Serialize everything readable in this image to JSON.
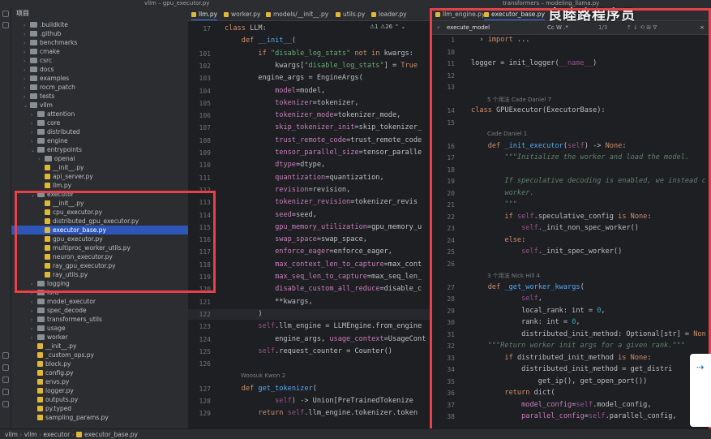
{
  "window": {
    "title_left": "vllm – gpu_executor.py",
    "title_right": "transformers – modeling_llama.py"
  },
  "project": {
    "header": "项目",
    "rows": [
      {
        "label": ".buildkite",
        "kind": "folder",
        "depth": 1,
        "arrow": "›"
      },
      {
        "label": ".github",
        "kind": "folder",
        "depth": 1,
        "arrow": "›"
      },
      {
        "label": "benchmarks",
        "kind": "folder",
        "depth": 1,
        "arrow": "›"
      },
      {
        "label": "cmake",
        "kind": "folder",
        "depth": 1,
        "arrow": "›"
      },
      {
        "label": "csrc",
        "kind": "folder",
        "depth": 1,
        "arrow": "›"
      },
      {
        "label": "docs",
        "kind": "folder",
        "depth": 1,
        "arrow": "›"
      },
      {
        "label": "examples",
        "kind": "folder",
        "depth": 1,
        "arrow": "›"
      },
      {
        "label": "rocm_patch",
        "kind": "folder",
        "depth": 1,
        "arrow": "›"
      },
      {
        "label": "tests",
        "kind": "folder",
        "depth": 1,
        "arrow": "›"
      },
      {
        "label": "vllm",
        "kind": "folder",
        "depth": 1,
        "arrow": "⌄"
      },
      {
        "label": "attention",
        "kind": "folder",
        "depth": 2,
        "arrow": "›"
      },
      {
        "label": "core",
        "kind": "folder",
        "depth": 2,
        "arrow": "›"
      },
      {
        "label": "distributed",
        "kind": "folder",
        "depth": 2,
        "arrow": "›"
      },
      {
        "label": "engine",
        "kind": "folder",
        "depth": 2,
        "arrow": "›"
      },
      {
        "label": "entrypoints",
        "kind": "folder",
        "depth": 2,
        "arrow": "⌄"
      },
      {
        "label": "openai",
        "kind": "folder",
        "depth": 3,
        "arrow": "›"
      },
      {
        "label": "__init__.py",
        "kind": "py",
        "depth": 3,
        "arrow": ""
      },
      {
        "label": "api_server.py",
        "kind": "py",
        "depth": 3,
        "arrow": ""
      },
      {
        "label": "llm.py",
        "kind": "py",
        "depth": 3,
        "arrow": ""
      },
      {
        "label": "executor",
        "kind": "folder",
        "depth": 2,
        "arrow": "⌄"
      },
      {
        "label": "__init__.py",
        "kind": "py",
        "depth": 3,
        "arrow": ""
      },
      {
        "label": "cpu_executor.py",
        "kind": "py",
        "depth": 3,
        "arrow": ""
      },
      {
        "label": "distributed_gpu_executor.py",
        "kind": "py",
        "depth": 3,
        "arrow": ""
      },
      {
        "label": "executor_base.py",
        "kind": "py",
        "depth": 3,
        "arrow": "",
        "selected": true
      },
      {
        "label": "gpu_executor.py",
        "kind": "py",
        "depth": 3,
        "arrow": ""
      },
      {
        "label": "multiproc_worker_utils.py",
        "kind": "py",
        "depth": 3,
        "arrow": ""
      },
      {
        "label": "neuron_executor.py",
        "kind": "py",
        "depth": 3,
        "arrow": ""
      },
      {
        "label": "ray_gpu_executor.py",
        "kind": "py",
        "depth": 3,
        "arrow": ""
      },
      {
        "label": "ray_utils.py",
        "kind": "py",
        "depth": 3,
        "arrow": ""
      },
      {
        "label": "logging",
        "kind": "folder",
        "depth": 2,
        "arrow": "›"
      },
      {
        "label": "lora",
        "kind": "folder",
        "depth": 2,
        "arrow": "›"
      },
      {
        "label": "model_executor",
        "kind": "folder",
        "depth": 2,
        "arrow": "›"
      },
      {
        "label": "spec_decode",
        "kind": "folder",
        "depth": 2,
        "arrow": "›"
      },
      {
        "label": "transformers_utils",
        "kind": "folder",
        "depth": 2,
        "arrow": "›"
      },
      {
        "label": "usage",
        "kind": "folder",
        "depth": 2,
        "arrow": "›"
      },
      {
        "label": "worker",
        "kind": "folder",
        "depth": 2,
        "arrow": "›"
      },
      {
        "label": "__init__.py",
        "kind": "py",
        "depth": 2,
        "arrow": ""
      },
      {
        "label": "_custom_ops.py",
        "kind": "py",
        "depth": 2,
        "arrow": ""
      },
      {
        "label": "block.py",
        "kind": "py",
        "depth": 2,
        "arrow": ""
      },
      {
        "label": "config.py",
        "kind": "py",
        "depth": 2,
        "arrow": ""
      },
      {
        "label": "envs.py",
        "kind": "py",
        "depth": 2,
        "arrow": ""
      },
      {
        "label": "logger.py",
        "kind": "py",
        "depth": 2,
        "arrow": ""
      },
      {
        "label": "outputs.py",
        "kind": "py",
        "depth": 2,
        "arrow": ""
      },
      {
        "label": "py.typed",
        "kind": "py",
        "depth": 2,
        "arrow": ""
      },
      {
        "label": "sampling_params.py",
        "kind": "py",
        "depth": 2,
        "arrow": ""
      }
    ]
  },
  "breadcrumb": {
    "b1": "vllm",
    "b2": "vllm",
    "b3": "executor",
    "b4": "executor_base.py"
  },
  "editor_left": {
    "tabs": [
      "llm.py",
      "worker.py",
      "models/__init__.py",
      "utils.py",
      "loader.py"
    ],
    "status": "⚠1 ⚠26 ⌃ ⌄",
    "lines": [
      {
        "n": "17",
        "html": "<span class='kw'>class</span> <span class='cls'>LLM</span>:"
      },
      {
        "n": "",
        "html": "    <span class='kw'>def</span> <span class='fn'>__init__</span>("
      },
      {
        "n": "101",
        "html": "        <span class='kw'>if</span> <span class='str'>\"disable_log_stats\"</span> <span class='kw'>not in</span> kwargs:"
      },
      {
        "n": "102",
        "html": "            kwargs[<span class='str'>\"disable_log_stats\"</span>] = <span class='kw'>True</span>"
      },
      {
        "n": "103",
        "html": "        engine_args = EngineArgs("
      },
      {
        "n": "104",
        "html": "            <span class='prm'>model</span>=model,"
      },
      {
        "n": "105",
        "html": "            <span class='prm'>tokenizer</span>=tokenizer,"
      },
      {
        "n": "106",
        "html": "            <span class='prm'>tokenizer_mode</span>=tokenizer_mode,"
      },
      {
        "n": "107",
        "html": "            <span class='prm'>skip_tokenizer_init</span>=skip_tokenizer_"
      },
      {
        "n": "108",
        "html": "            <span class='prm'>trust_remote_code</span>=trust_remote_code"
      },
      {
        "n": "109",
        "html": "            <span class='prm'>tensor_parallel_size</span>=tensor_paralle"
      },
      {
        "n": "110",
        "html": "            <span class='prm'>dtype</span>=dtype,"
      },
      {
        "n": "111",
        "html": "            <span class='prm'>quantization</span>=quantization,"
      },
      {
        "n": "112",
        "html": "            <span class='prm'>revision</span>=revision,"
      },
      {
        "n": "113",
        "html": "            <span class='prm'>tokenizer_revision</span>=tokenizer_revis"
      },
      {
        "n": "114",
        "html": "            <span class='prm'>seed</span>=seed,"
      },
      {
        "n": "115",
        "html": "            <span class='prm'>gpu_memory_utilization</span>=gpu_memory_u"
      },
      {
        "n": "116",
        "html": "            <span class='prm'>swap_space</span>=swap_space,"
      },
      {
        "n": "117",
        "html": "            <span class='prm'>enforce_eager</span>=enforce_eager,"
      },
      {
        "n": "118",
        "html": "            <span class='prm'>max_context_len_to_capture</span>=max_cont"
      },
      {
        "n": "119",
        "html": "            <span class='prm'>max_seq_len_to_capture</span>=max_seq_len_"
      },
      {
        "n": "120",
        "html": "            <span class='prm'>disable_custom_all_reduce</span>=disable_c"
      },
      {
        "n": "121",
        "html": "            **kwargs,"
      },
      {
        "n": "122",
        "html": "        )"
      },
      {
        "n": "123",
        "html": "        <span class='slf'>self</span>.llm_engine = LLMEngine.from_engine"
      },
      {
        "n": "124",
        "html": "            engine_args, <span class='prm'>usage_context</span>=UsageCont"
      },
      {
        "n": "125",
        "html": "        <span class='slf'>self</span>.request_counter = Counter()"
      },
      {
        "n": "126",
        "html": ""
      },
      {
        "n": "",
        "hint": "Woosuk Kwon 2"
      },
      {
        "n": "127",
        "html": "    <span class='kw'>def</span> <span class='fn'>get_tokenizer</span>("
      },
      {
        "n": "128",
        "html": "            <span class='slf'>self</span>) -> Union[PreTrainedTokenize"
      },
      {
        "n": "129",
        "html": "        <span class='kw'>return</span> <span class='slf'>self</span>.llm_engine.tokenizer.token"
      }
    ]
  },
  "editor_right": {
    "tabs": [
      "llm_engine.py",
      "executor_base.py"
    ],
    "search": {
      "value": "execute_model",
      "count": "1/3",
      "opts": "Cc W .*"
    },
    "watermark": "良睦路程序员",
    "lines": [
      {
        "n": "1",
        "html": "  › <span class='kw'>import</span> ..."
      },
      {
        "n": "10",
        "html": ""
      },
      {
        "n": "11",
        "html": "logger = init_logger(<span class='slf'>__name__</span>)"
      },
      {
        "n": "12",
        "html": ""
      },
      {
        "n": "13",
        "html": ""
      },
      {
        "n": "",
        "hint": "5 个用法   Cade Daniel 7"
      },
      {
        "n": "14",
        "html": "<span class='kw'>class</span> <span class='cls'>GPUExecutor</span>(ExecutorBase):"
      },
      {
        "n": "15",
        "html": ""
      },
      {
        "n": "",
        "hint": "Cade Daniel 1"
      },
      {
        "n": "16",
        "html": "    <span class='kw'>def</span> <span class='fn'>_init_executor</span>(<span class='slf'>self</span>) -> <span class='kw'>None</span>:"
      },
      {
        "n": "17",
        "html": "        <span class='doc'>\"\"\"Initialize the worker and load the model.</span>"
      },
      {
        "n": "18",
        "html": ""
      },
      {
        "n": "19",
        "html": "        <span class='doc'>If speculative decoding is enabled, we instead c</span>"
      },
      {
        "n": "20",
        "html": "        <span class='doc'>worker.</span>"
      },
      {
        "n": "21",
        "html": "        <span class='doc'>\"\"\"</span>"
      },
      {
        "n": "22",
        "html": "        <span class='kw'>if</span> <span class='slf'>self</span>.speculative_config <span class='kw'>is None</span>:"
      },
      {
        "n": "23",
        "html": "            <span class='slf'>self</span>._init_non_spec_worker()"
      },
      {
        "n": "24",
        "html": "        <span class='kw'>else</span>:"
      },
      {
        "n": "25",
        "html": "            <span class='slf'>self</span>._init_spec_worker()"
      },
      {
        "n": "26",
        "html": ""
      },
      {
        "n": "",
        "hint": "3 个用法   Nick Hill 4"
      },
      {
        "n": "27",
        "html": "    <span class='kw'>def</span> <span class='fn'>_get_worker_kwargs</span>("
      },
      {
        "n": "28",
        "html": "            <span class='slf'>self</span>,"
      },
      {
        "n": "29",
        "html": "            local_rank: int = <span class='num'>0</span>,"
      },
      {
        "n": "30",
        "html": "            rank: int = <span class='num'>0</span>,"
      },
      {
        "n": "31",
        "html": "            distributed_init_method: Optional[str] = <span class='kw'>Non</span>"
      },
      {
        "n": "32",
        "html": "    <span class='doc'>\"\"\"Return worker init args for a given rank.\"\"\"</span>"
      },
      {
        "n": "33",
        "html": "        <span class='kw'>if</span> distributed_init_method <span class='kw'>is None</span>:"
      },
      {
        "n": "34",
        "html": "            distributed_init_method = get_distri"
      },
      {
        "n": "35",
        "html": "                get_ip(), get_open_port())"
      },
      {
        "n": "36",
        "html": "        <span class='kw'>return</span> dict("
      },
      {
        "n": "37",
        "html": "            <span class='prm'>model_config</span>=<span class='slf'>self</span>.model_config,"
      },
      {
        "n": "38",
        "html": "            <span class='prm'>parallel_config</span>=<span class='slf'>self</span>.parallel_config,"
      }
    ]
  }
}
